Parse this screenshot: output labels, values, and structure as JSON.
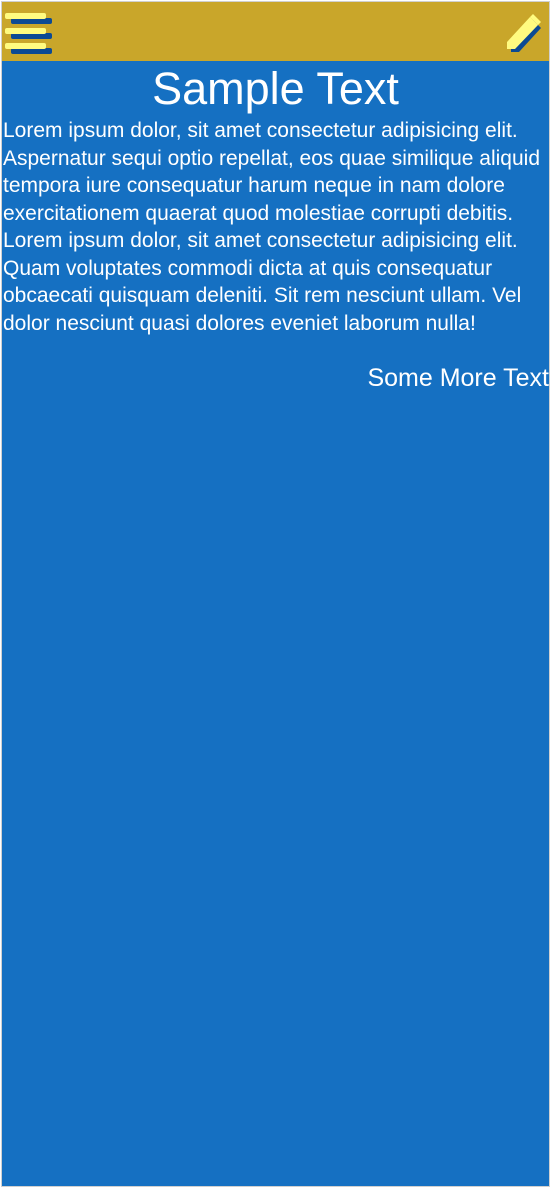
{
  "header": {
    "menu_icon": "hamburger-menu-icon",
    "edit_icon": "pencil-icon",
    "colors": {
      "header": "#c9a62a",
      "body": "#1570c2",
      "icon": "#fffb80",
      "icon_shadow": "#0c4a94"
    }
  },
  "main": {
    "title": "Sample Text",
    "paragraphs": [
      "Lorem ipsum dolor, sit amet consectetur adipisicing elit. Aspernatur sequi optio repellat, eos quae similique aliquid tempora iure consequatur harum neque in nam dolore exercitationem quaerat quod molestiae corrupti debitis.",
      "Lorem ipsum dolor, sit amet consectetur adipisicing elit. Quam voluptates commodi dicta at quis consequatur obcaecati quisquam deleniti. Sit rem nesciunt ullam. Vel dolor nesciunt quasi dolores eveniet laborum nulla!"
    ],
    "more_text": "Some More Text"
  }
}
